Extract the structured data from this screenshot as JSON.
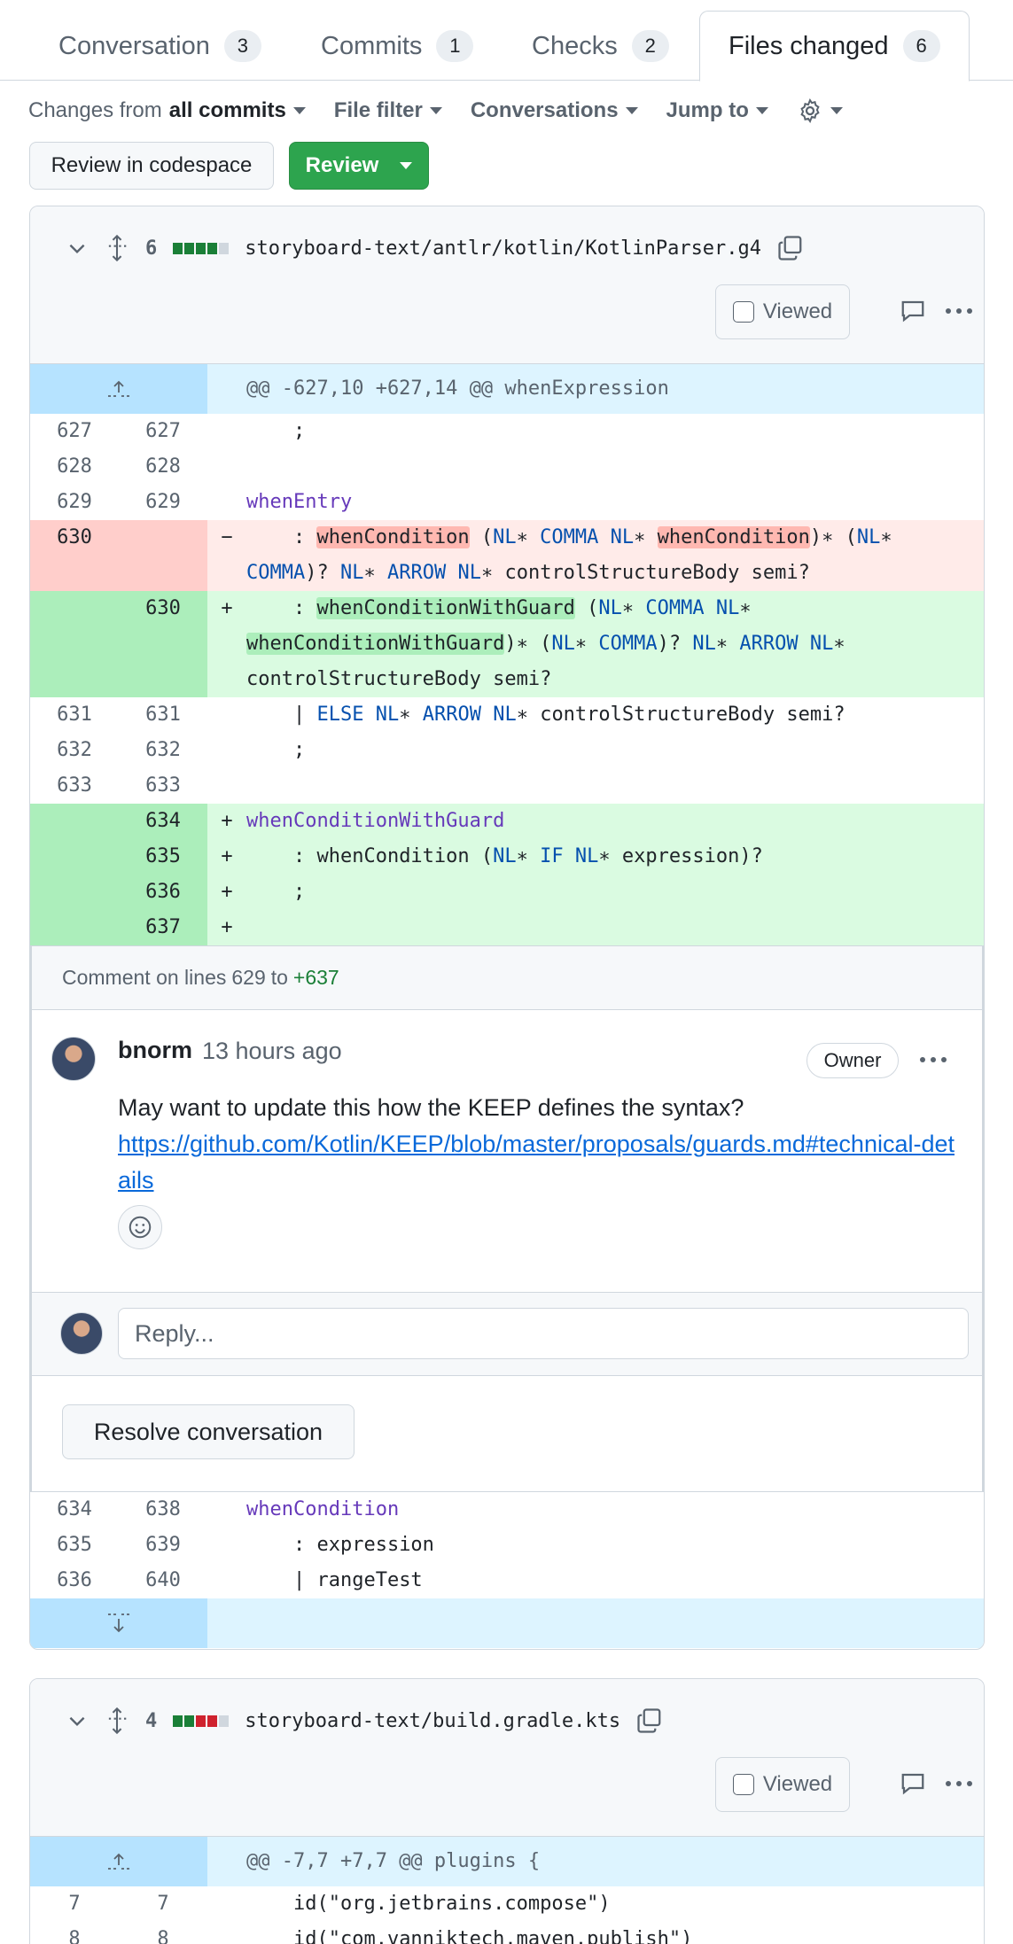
{
  "tabs": [
    {
      "label": "Conversation",
      "count": "3"
    },
    {
      "label": "Commits",
      "count": "1"
    },
    {
      "label": "Checks",
      "count": "2"
    },
    {
      "label": "Files changed",
      "count": "6"
    }
  ],
  "toolbar": {
    "changes_prefix": "Changes from",
    "changes_value": "all commits",
    "file_filter": "File filter",
    "conversations": "Conversations",
    "jump_to": "Jump to"
  },
  "buttons": {
    "codespace": "Review in codespace",
    "review": "Review"
  },
  "file1": {
    "diff_count": "6",
    "name": "storyboard-text/antlr/kotlin/KotlinParser.g4",
    "viewed": "Viewed",
    "hunk": "@@ -627,10 +627,14 @@ whenExpression",
    "bottom_lines": [
      {
        "old": "634",
        "new": "638",
        "code": "whenCondition"
      },
      {
        "old": "635",
        "new": "639",
        "code": "    : expression"
      },
      {
        "old": "636",
        "new": "640",
        "code": "    | rangeTest"
      }
    ]
  },
  "comment": {
    "header_prefix": "Comment on lines",
    "from_line": "629",
    "to_word": "to",
    "to_line": "+637",
    "author": "bnorm",
    "time": "13 hours ago",
    "role": "Owner",
    "text": "May want to update this how the KEEP defines the syntax?",
    "link": "https://github.com/Kotlin/KEEP/blob/master/proposals/guards.md#technical-details",
    "reply_placeholder": "Reply...",
    "resolve": "Resolve conversation"
  },
  "file2": {
    "diff_count": "4",
    "name": "storyboard-text/build.gradle.kts",
    "viewed": "Viewed",
    "hunk": "@@ -7,7 +7,7 @@ plugins {",
    "lines": [
      {
        "old": "7",
        "new": "7",
        "code": "    id(\"org.jetbrains.compose\")"
      },
      {
        "old": "8",
        "new": "8",
        "code": "    id(\"com.vanniktech.maven.publish\")"
      }
    ]
  },
  "colors": {
    "add": "#1a7f37",
    "del": "#cf222e",
    "neutral": "#d0d7de",
    "link": "#0969da"
  }
}
